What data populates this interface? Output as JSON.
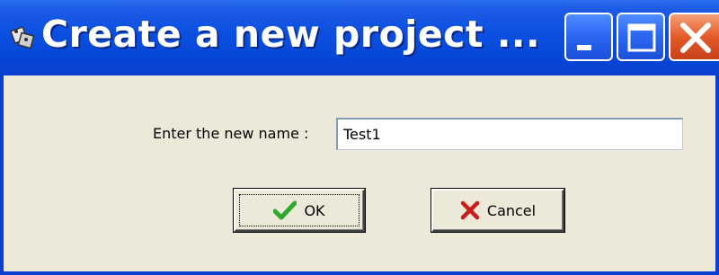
{
  "window": {
    "title": "Create a new project ..."
  },
  "titlebar_buttons": {
    "minimize_icon": "minimize-icon",
    "maximize_icon": "maximize-icon",
    "close_icon": "close-icon"
  },
  "form": {
    "name_label": "Enter the new name :",
    "name_value": "Test1"
  },
  "buttons": {
    "ok_label": "OK",
    "ok_icon": "checkmark-icon",
    "cancel_label": "Cancel",
    "cancel_icon": "x-mark-icon"
  },
  "colors": {
    "titlebar": "#0a3fcf",
    "body": "#ece9d8",
    "ok_check": "#2ea82e",
    "cancel_x": "#c81e1e",
    "close_button": "#e35b2a"
  }
}
